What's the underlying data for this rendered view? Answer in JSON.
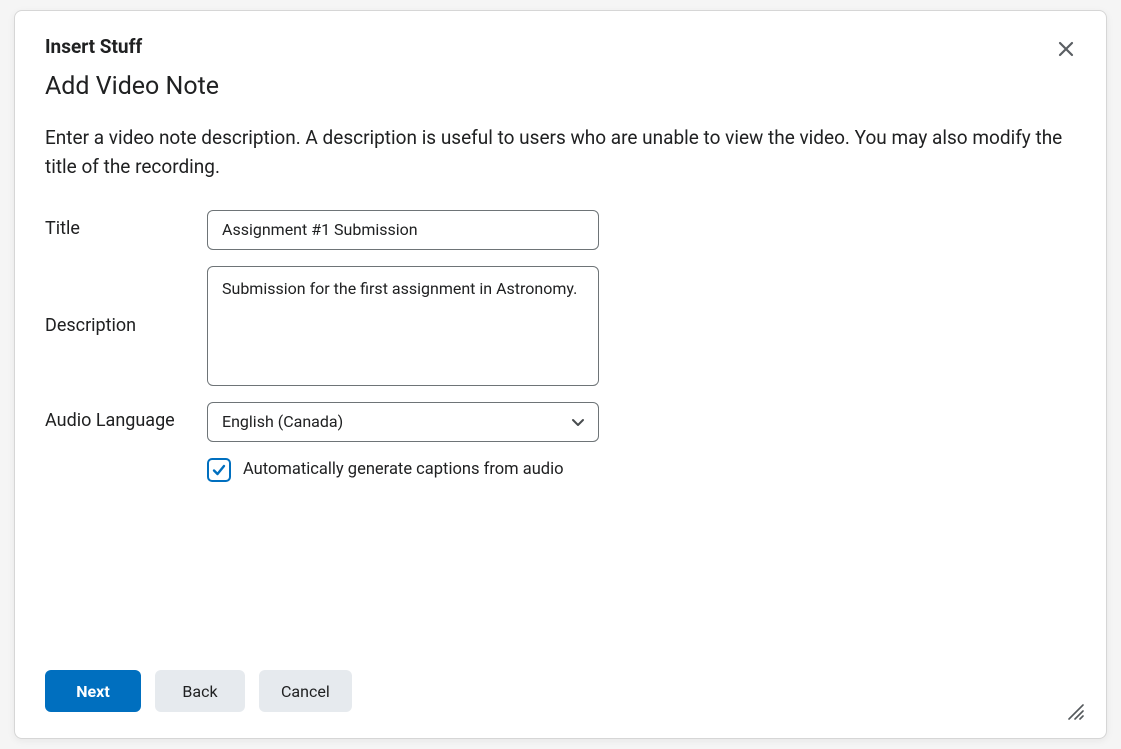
{
  "header": {
    "insert_stuff": "Insert Stuff",
    "add_video_note": "Add Video Note"
  },
  "body": {
    "intro": "Enter a video note description. A description is useful to users who are unable to view the video. You may also modify the title of the recording.",
    "title_label": "Title",
    "title_value": "Assignment #1 Submission",
    "description_label": "Description",
    "description_value": "Submission for the first assignment in Astronomy.",
    "audio_language_label": "Audio Language",
    "audio_language_value": "English (Canada)",
    "checkbox_label": "Automatically generate captions from audio",
    "checkbox_checked": true
  },
  "footer": {
    "next": "Next",
    "back": "Back",
    "cancel": "Cancel"
  }
}
